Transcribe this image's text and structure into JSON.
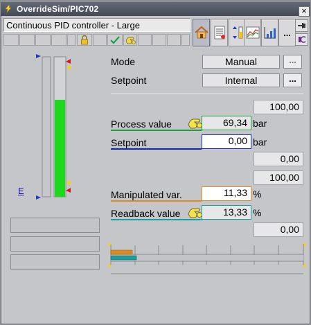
{
  "window": {
    "title": "OverrideSim/PIC702",
    "close_label": "×"
  },
  "header": {
    "faceplate_name": "Continuous PID controller - Large",
    "more_label": "..."
  },
  "mode": {
    "label": "Mode",
    "value": "Manual",
    "more": "..."
  },
  "setpoint_source": {
    "label": "Setpoint",
    "value": "Internal",
    "more": "..."
  },
  "process_value": {
    "label": "Process value",
    "value": "69,34",
    "unit": "bar",
    "range_high": "100,00"
  },
  "setpoint": {
    "label": "Setpoint",
    "value": "0,00",
    "unit": "bar",
    "range_low": "0,00"
  },
  "manipulated": {
    "label": "Manipulated var.",
    "value": "11,33",
    "unit": "%",
    "range_high": "100,00"
  },
  "readback": {
    "label": "Readback value",
    "value": "13,33",
    "unit": "%",
    "range_low": "0,00"
  },
  "bargraph": {
    "label": "E",
    "level_fraction": 0.6934
  },
  "horizontal_bars": {
    "manipulated_fraction": 0.1133,
    "readback_fraction": 0.1333
  },
  "colors": {
    "pv_accent": "#1e9b3a",
    "sp_accent": "#1627a6",
    "mv_accent": "#e08a1e",
    "rb_accent": "#1a9e9e",
    "bar_green": "#1ed81e"
  }
}
